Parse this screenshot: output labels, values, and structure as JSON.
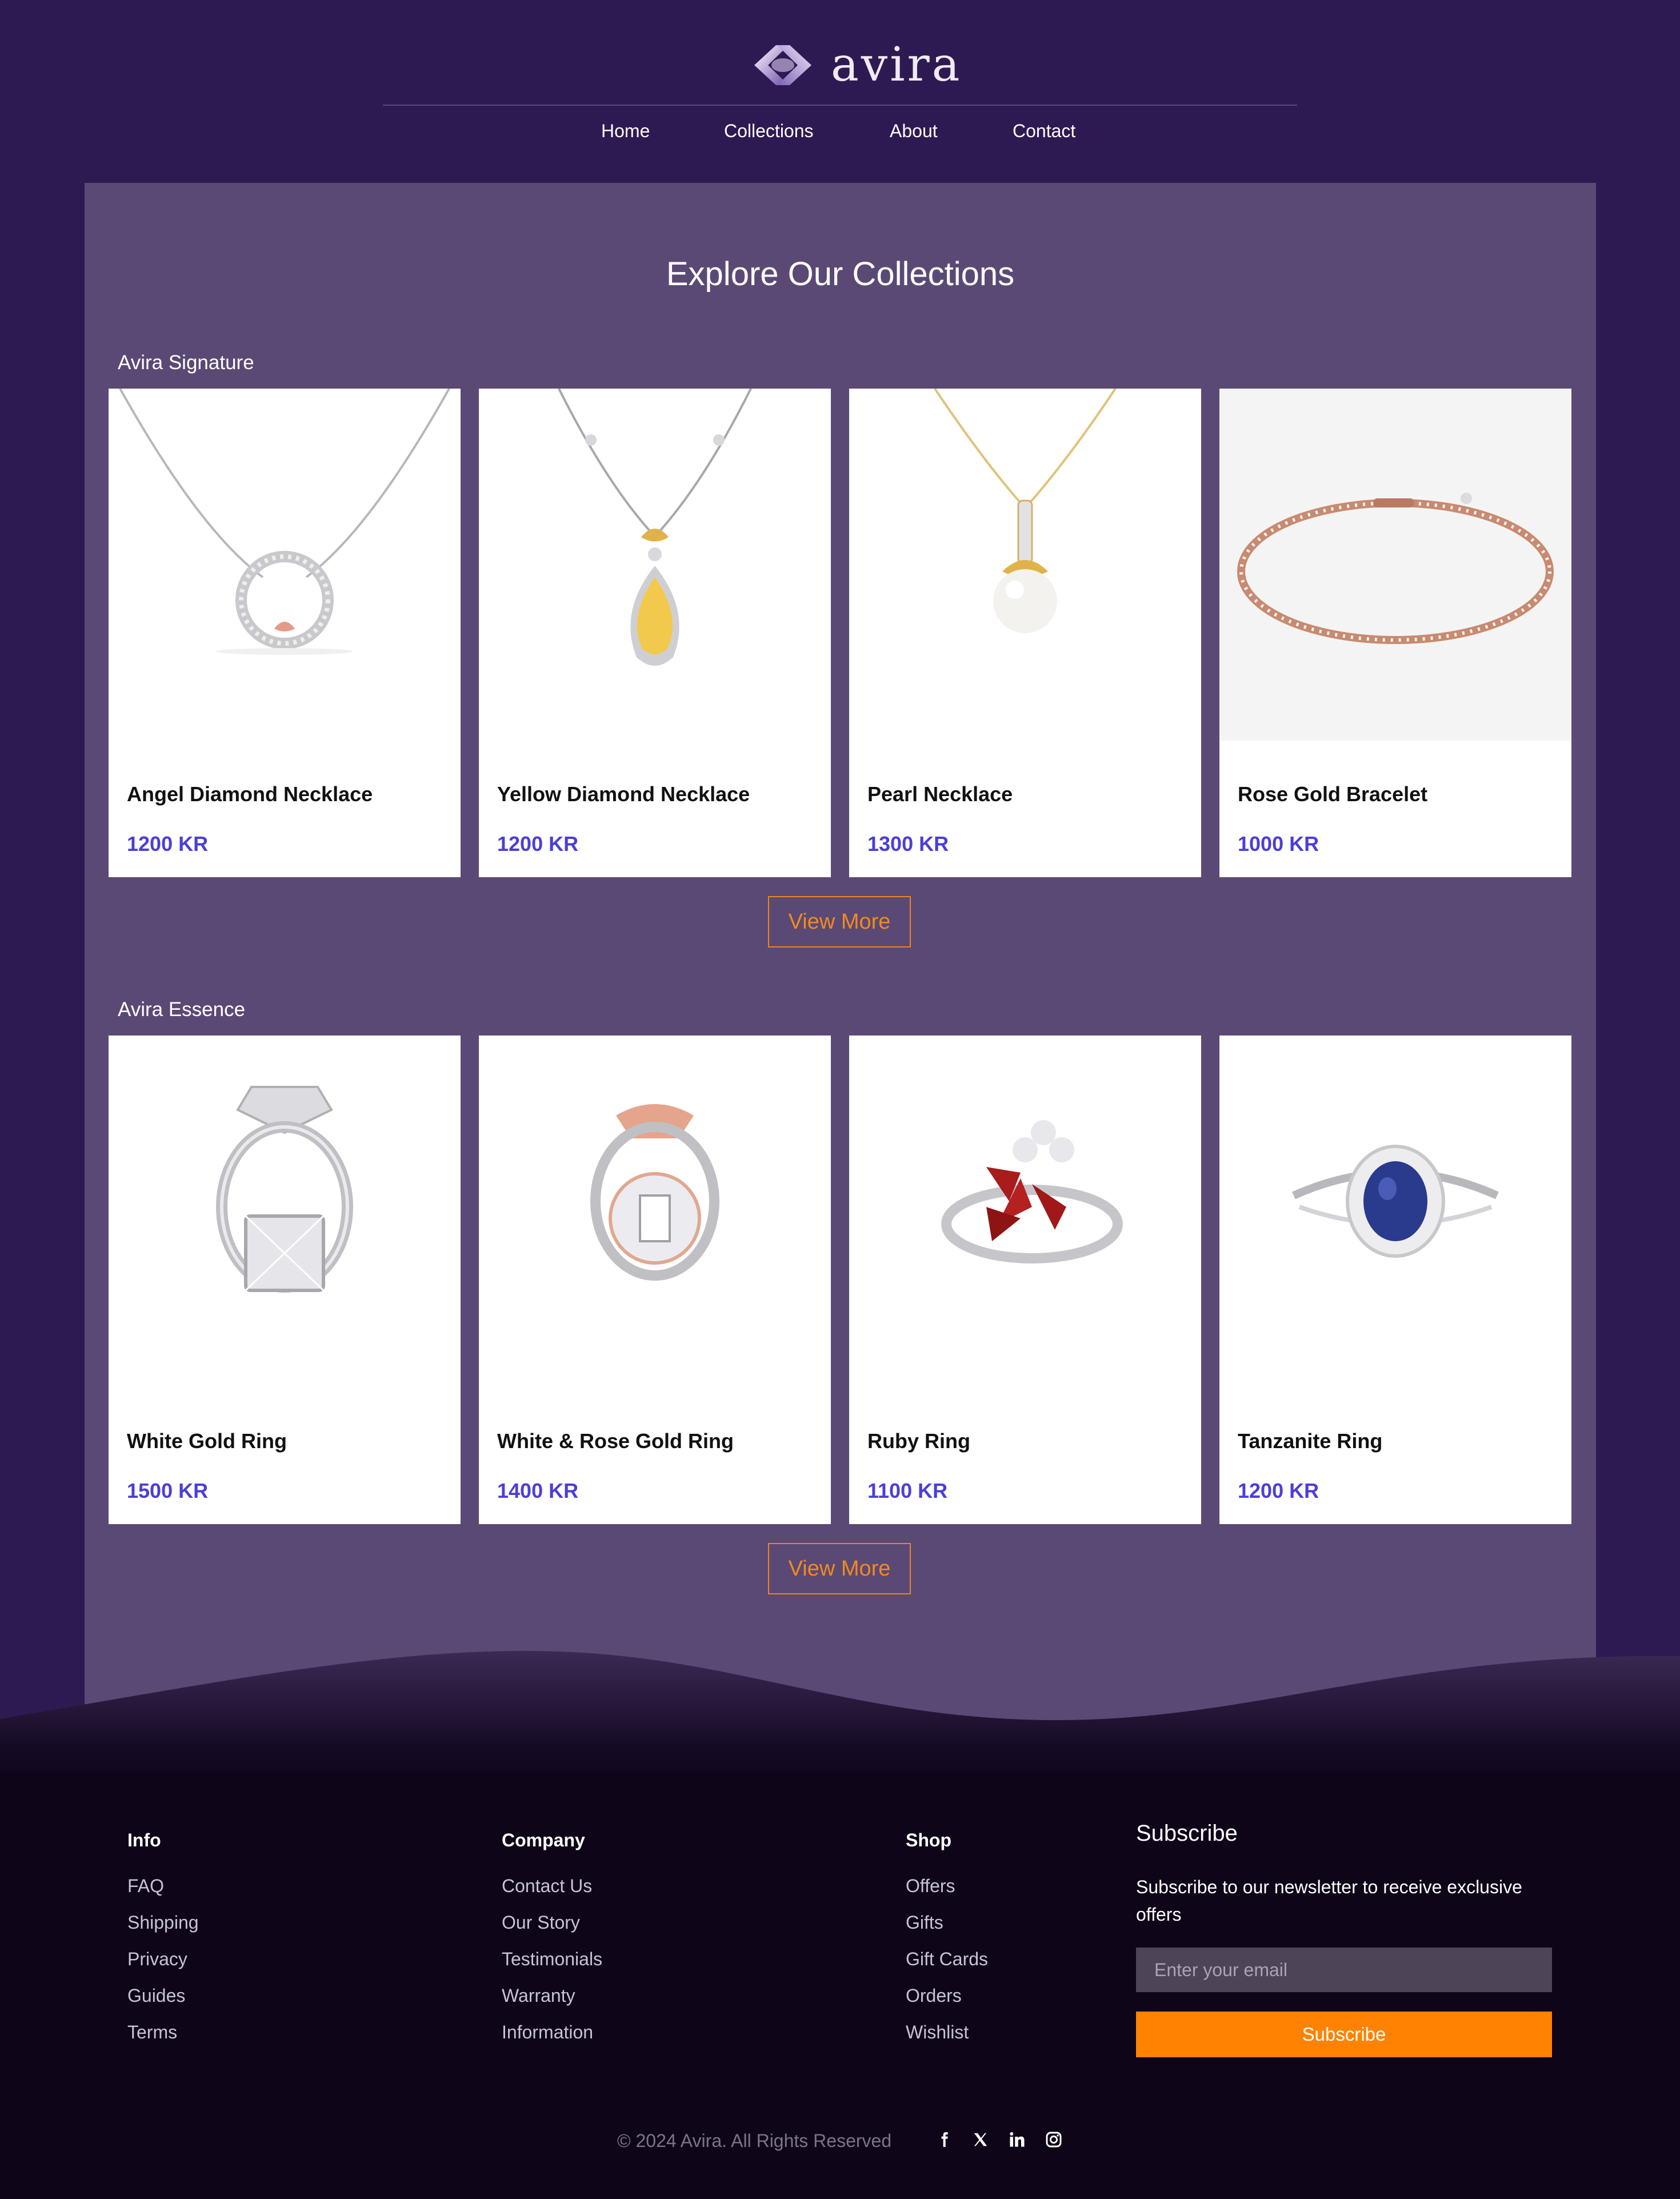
{
  "brand": {
    "name": "avira"
  },
  "nav": [
    {
      "label": "Home"
    },
    {
      "label": "Collections"
    },
    {
      "label": "About"
    },
    {
      "label": "Contact"
    }
  ],
  "main": {
    "title": "Explore Our Collections",
    "sections": [
      {
        "label": "Avira Signature",
        "view_more": "View More",
        "products": [
          {
            "name": "Angel Diamond Necklace",
            "price": "1200 KR"
          },
          {
            "name": "Yellow Diamond Necklace",
            "price": "1200 KR"
          },
          {
            "name": "Pearl Necklace",
            "price": "1300 KR"
          },
          {
            "name": "Rose Gold Bracelet",
            "price": "1000 KR"
          }
        ]
      },
      {
        "label": "Avira Essence",
        "view_more": "View More",
        "products": [
          {
            "name": "White Gold Ring",
            "price": "1500 KR"
          },
          {
            "name": "White & Rose Gold Ring",
            "price": "1400 KR"
          },
          {
            "name": "Ruby Ring",
            "price": "1100 KR"
          },
          {
            "name": "Tanzanite Ring",
            "price": "1200 KR"
          }
        ]
      }
    ]
  },
  "footer": {
    "columns": [
      {
        "title": "Info",
        "links": [
          "FAQ",
          "Shipping",
          "Privacy",
          "Guides",
          "Terms"
        ]
      },
      {
        "title": "Company",
        "links": [
          "Contact Us",
          "Our Story",
          "Testimonials",
          "Warranty",
          "Information"
        ]
      },
      {
        "title": "Shop",
        "links": [
          "Offers",
          "Gifts",
          "Gift Cards",
          "Orders",
          "Wishlist"
        ]
      }
    ],
    "subscribe": {
      "title": "Subscribe",
      "text": "Subscribe to our newsletter to receive exclusive offers",
      "placeholder": "Enter your email",
      "button": "Subscribe"
    },
    "copyright": "© 2024 Avira. All Rights Reserved",
    "social": [
      "facebook-icon",
      "x-icon",
      "linkedin-icon",
      "instagram-icon"
    ]
  },
  "colors": {
    "background": "#2e1a52",
    "panel": "#5b4975",
    "footer": "#0e0519",
    "price": "#4b3ed8",
    "accent": "#ff8200"
  }
}
